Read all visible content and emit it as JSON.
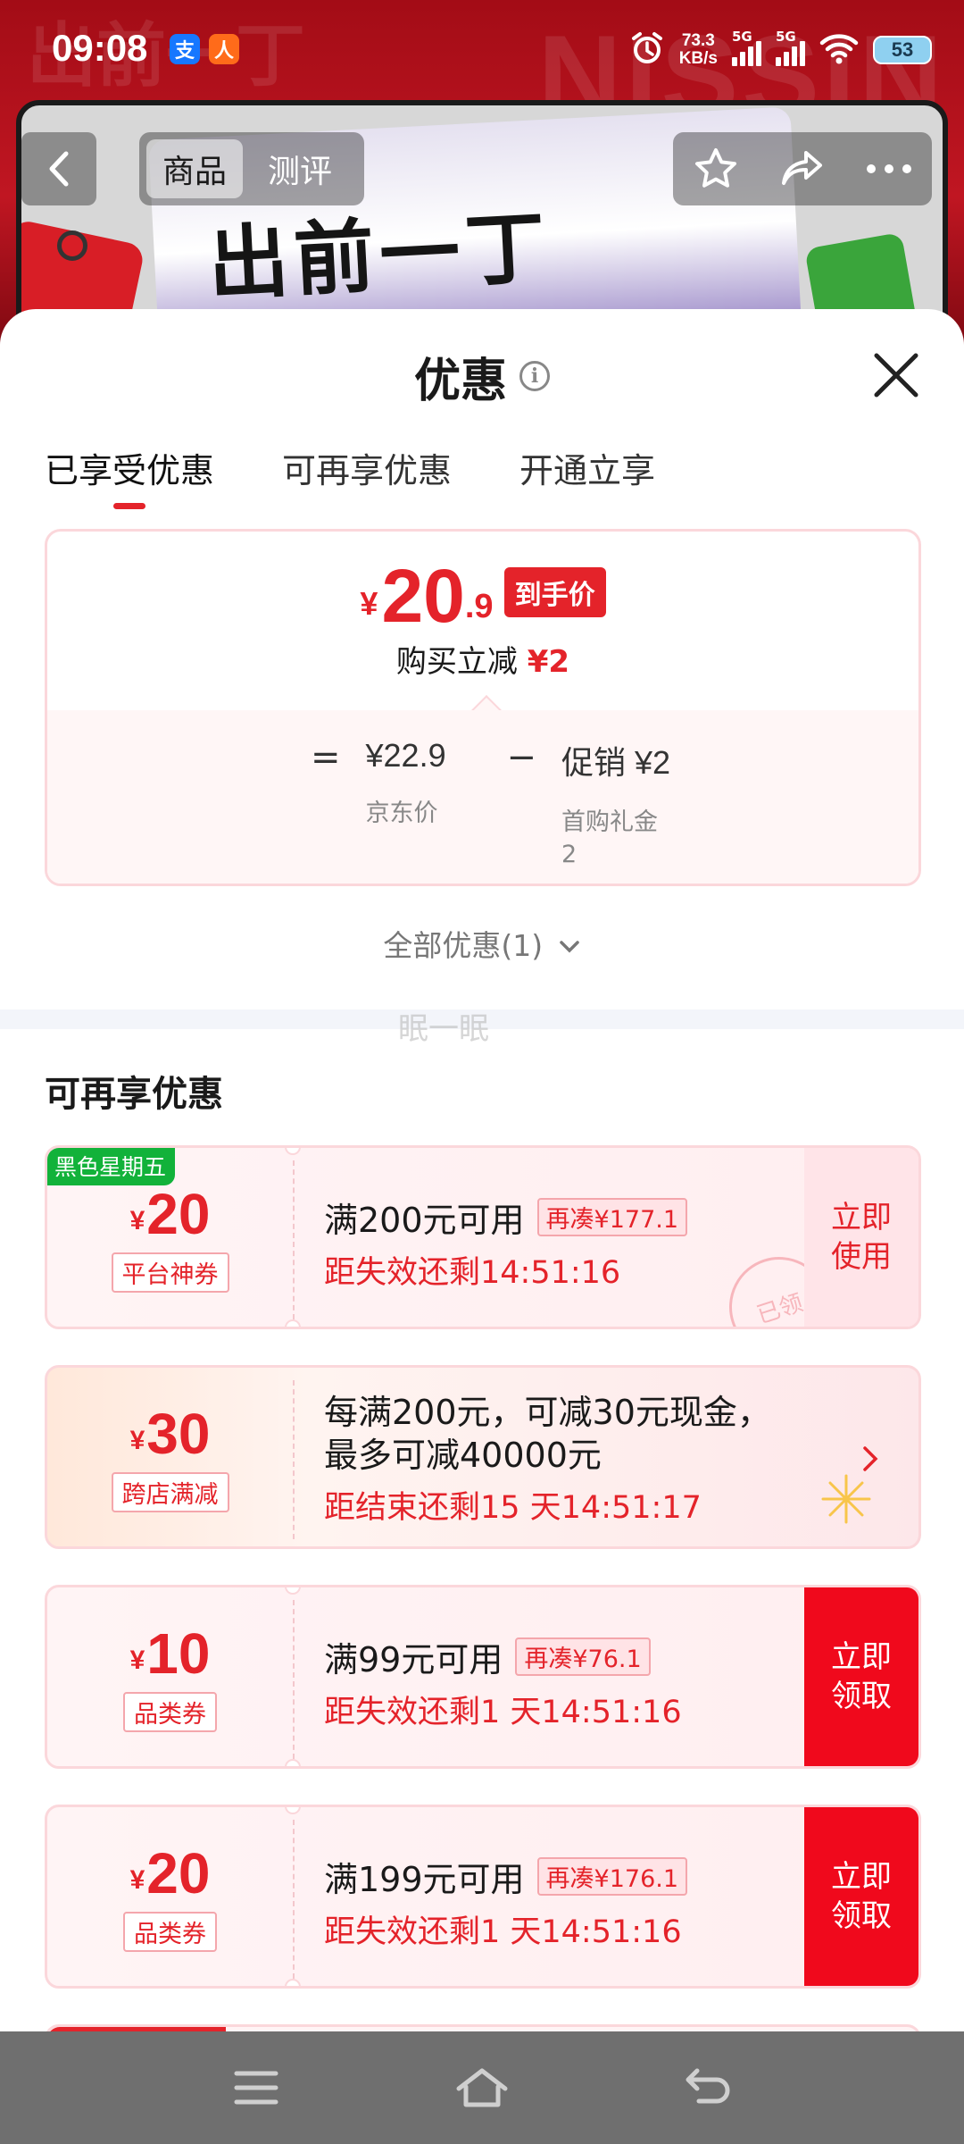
{
  "status_bar": {
    "time": "09:08",
    "apps": [
      "支",
      "人"
    ],
    "net_speed_value": "73.3",
    "net_speed_unit": "KB/s",
    "sim1": "5G",
    "sim2": "5G",
    "battery": "53"
  },
  "hero": {
    "brand_left": "出前一丁",
    "brand_right": "NISSIN",
    "pack_text": "出前一丁"
  },
  "nav": {
    "tabs": [
      {
        "label": "商品",
        "active": true
      },
      {
        "label": "测评",
        "active": false
      }
    ]
  },
  "sheet": {
    "title": "优惠",
    "tabs": [
      {
        "label": "已享受优惠",
        "active": true
      },
      {
        "label": "可再享优惠",
        "active": false
      },
      {
        "label": "开通立享",
        "active": false
      }
    ],
    "price": {
      "yen": "¥",
      "integer": "20",
      "decimal": ".9",
      "tag": "到手价",
      "sub_label": "购买立减",
      "sub_value": "¥2"
    },
    "formula": {
      "eq": "=",
      "base_value": "¥22.9",
      "base_label": "京东价",
      "minus": "−",
      "discount_value": "促销 ¥2",
      "discount_label": "首购礼金 2"
    },
    "all_promos": "全部优惠(1)",
    "watermark": "眠一眠",
    "section_title": "可再享优惠",
    "coupons": [
      {
        "badge": "黑色星期五",
        "yen": "¥",
        "amount": "20",
        "type": "平台神券",
        "condition": "满200元可用",
        "gap": "再凑¥177.1",
        "timer": "距失效还剩14:51:16",
        "action": "立即使用",
        "stamp": "已领"
      },
      {
        "yen": "¥",
        "amount": "30",
        "type": "跨店满减",
        "desc_line1": "每满200元，可减30元现金，",
        "desc_line2": "最多可减40000元",
        "timer": "距结束还剩15 天14:51:17"
      },
      {
        "yen": "¥",
        "amount": "10",
        "type": "品类券",
        "condition": "满99元可用",
        "gap": "再凑¥76.1",
        "timer": "距失效还剩1 天14:51:16",
        "action": "立即领取"
      },
      {
        "yen": "¥",
        "amount": "20",
        "type": "品类券",
        "condition": "满199元可用",
        "gap": "再凑¥176.1",
        "timer": "距失效还剩1 天14:51:16",
        "action": "立即领取"
      }
    ]
  },
  "colors": {
    "accent": "#e4232a",
    "header_red": "#b8121b",
    "badge_green": "#12b23a"
  },
  "icons": [
    "back-icon",
    "star-icon",
    "share-icon",
    "more-icon",
    "info-icon",
    "close-icon",
    "chevron-down-icon",
    "chevron-right-icon",
    "menu-icon",
    "home-icon",
    "return-icon",
    "alarm-icon",
    "wifi-icon"
  ]
}
